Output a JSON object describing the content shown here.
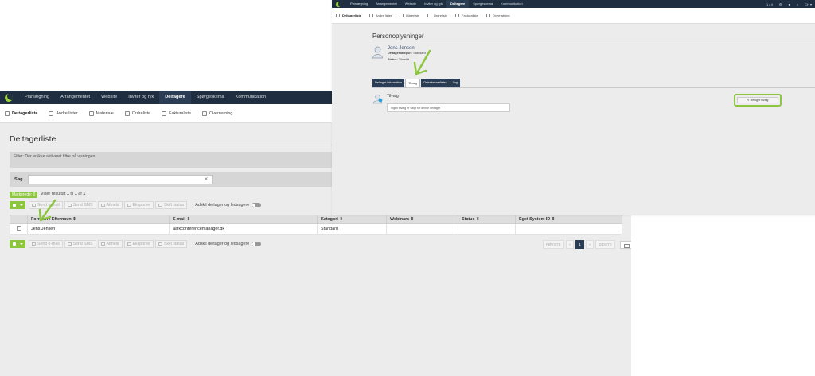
{
  "left": {
    "nav": [
      "Planlægning",
      "Arrangementet",
      "Website",
      "Invitér og ryk",
      "Deltagere",
      "Spørgeskema",
      "Kommunikation"
    ],
    "nav_active": "Deltagere",
    "subnav": [
      "Deltagerliste",
      "Andre lister",
      "Materiale",
      "Ordreliste",
      "Fakturaliste",
      "Overnatning"
    ],
    "page_title": "Deltagerliste",
    "filter_label": "Filter:",
    "filter_text": "Der er ikke aktiveret filtre på visningen",
    "search_label": "Søg",
    "search_value": "",
    "mark_badge": "Markerede: 0",
    "result_prefix": "Viser resultat",
    "result_from": "1",
    "result_mid": "til",
    "result_to": "1",
    "result_of": "af",
    "result_total": "1",
    "toolbar": [
      "Send e-mail",
      "Send SMS",
      "Afmeld",
      "Eksporter",
      "Skift status"
    ],
    "toggle_label": "Adskil deltager og ledsagere",
    "columns": [
      "Fornavn",
      "Efternavn",
      "E-mail",
      "Kategori",
      "Webinars",
      "Status",
      "Eget System ID"
    ],
    "row": {
      "fornavn": "Jens",
      "efternavn": "Jensen",
      "email": "aafkconferencemanager.dk",
      "kategori": "Standard",
      "webinars": "",
      "status": "",
      "eget_id": ""
    },
    "pager": {
      "first": "FØRSTE",
      "prev": "«",
      "page": "1",
      "next": "»",
      "last": "SIDSTE"
    }
  },
  "right": {
    "nav": [
      "Planlægning",
      "Arrangementet",
      "Website",
      "Invitér og ryk",
      "Deltagere",
      "Spørgeskema",
      "Kommunikation"
    ],
    "nav_active": "Deltagere",
    "nav_right": [
      "1 / 4",
      "CH ▾"
    ],
    "subnav": [
      "Deltagerliste",
      "Andre lister",
      "Materiale",
      "Ordreliste",
      "Fakturaliste",
      "Overnatning"
    ],
    "title": "Personoplysninger",
    "name": "Jens Jensen",
    "category_label": "Deltagerkategori:",
    "category_value": "Standard",
    "status_label": "Status:",
    "status_value": "Tilmeldt",
    "tabs": [
      "Deltager information",
      "Tilvalg",
      "Ordrebekræftelse",
      "Log"
    ],
    "active_tab": "Tilvalg",
    "section_title": "Tilvalg",
    "section_text": "Ingen tilvalg er valgt for denne deltager",
    "edit_button": "Rediger tilvalg"
  },
  "colors": {
    "nav_bg": "#1f2e40",
    "accent": "#8cc63f",
    "tab_bg": "#2b3d54"
  }
}
